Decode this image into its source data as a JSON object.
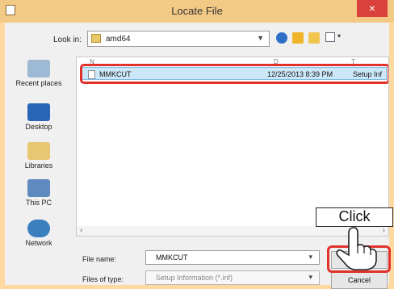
{
  "window": {
    "title": "Locate File",
    "close_glyph": "×"
  },
  "toolbar": {
    "look_in_label": "Look in:",
    "look_in_value": "amd64",
    "icons": [
      "back-icon",
      "up-folder-icon",
      "new-folder-icon",
      "view-menu-icon"
    ]
  },
  "places": [
    {
      "label": "Recent places",
      "icon": "recent-places-icon"
    },
    {
      "label": "Desktop",
      "icon": "desktop-icon"
    },
    {
      "label": "Libraries",
      "icon": "libraries-icon"
    },
    {
      "label": "This PC",
      "icon": "this-pc-icon"
    },
    {
      "label": "Network",
      "icon": "network-icon"
    }
  ],
  "file_list": {
    "rows": [
      {
        "name": "MMKCUT",
        "date": "12/25/2013 8:39 PM",
        "type": "Setup Inf"
      }
    ]
  },
  "footer": {
    "file_name_label": "File name:",
    "file_name_value": "MMKCUT",
    "files_of_type_label": "Files of type:",
    "files_of_type_value": "Setup Information (*.inf)",
    "open_label": "Open",
    "cancel_label": "Cancel"
  },
  "callout": {
    "text": "Click"
  },
  "colors": {
    "highlight": "#e0312b",
    "title_bar": "#f3c986",
    "selection": "#cce8f8"
  }
}
